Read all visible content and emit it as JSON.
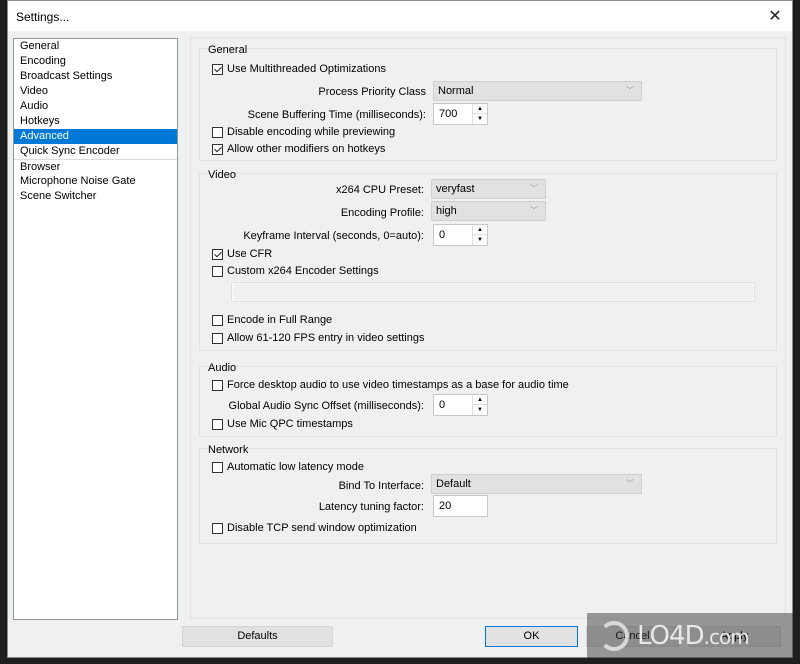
{
  "window": {
    "title": "Settings...",
    "close_icon": "close-icon"
  },
  "sidebar": {
    "items": [
      {
        "label": "General",
        "selected": false
      },
      {
        "label": "Encoding",
        "selected": false
      },
      {
        "label": "Broadcast Settings",
        "selected": false
      },
      {
        "label": "Video",
        "selected": false
      },
      {
        "label": "Audio",
        "selected": false
      },
      {
        "label": "Hotkeys",
        "selected": false
      },
      {
        "label": "Advanced",
        "selected": true
      },
      {
        "label": "Quick Sync Encoder",
        "selected": false
      },
      {
        "label": "Browser",
        "selected": false
      },
      {
        "label": "Microphone Noise Gate",
        "selected": false
      },
      {
        "label": "Scene Switcher",
        "selected": false
      }
    ]
  },
  "general": {
    "title": "General",
    "use_multithreaded": {
      "label": "Use Multithreaded Optimizations",
      "checked": true
    },
    "process_priority": {
      "label": "Process Priority Class",
      "value": "Normal"
    },
    "scene_buffering": {
      "label": "Scene Buffering Time (milliseconds):",
      "value": "700"
    },
    "disable_encoding_preview": {
      "label": "Disable encoding while previewing",
      "checked": false
    },
    "allow_modifiers": {
      "label": "Allow other modifiers on hotkeys",
      "checked": true
    }
  },
  "video": {
    "title": "Video",
    "cpu_preset": {
      "label": "x264 CPU Preset:",
      "value": "veryfast"
    },
    "encoding_profile": {
      "label": "Encoding Profile:",
      "value": "high"
    },
    "keyframe_interval": {
      "label": "Keyframe Interval (seconds, 0=auto):",
      "value": "0"
    },
    "use_cfr": {
      "label": "Use CFR",
      "checked": true
    },
    "custom_x264": {
      "label": "Custom x264 Encoder Settings",
      "checked": false,
      "value": ""
    },
    "full_range": {
      "label": "Encode in Full Range",
      "checked": false
    },
    "allow_high_fps": {
      "label": "Allow 61-120 FPS entry in video settings",
      "checked": false
    }
  },
  "audio": {
    "title": "Audio",
    "force_desktop_audio": {
      "label": "Force desktop audio to use video timestamps as a base for audio time",
      "checked": false
    },
    "sync_offset": {
      "label": "Global Audio Sync Offset (milliseconds):",
      "value": "0"
    },
    "mic_qpc": {
      "label": "Use Mic QPC timestamps",
      "checked": false
    }
  },
  "network": {
    "title": "Network",
    "auto_low_latency": {
      "label": "Automatic low latency mode",
      "checked": false
    },
    "bind_interface": {
      "label": "Bind To Interface:",
      "value": "Default"
    },
    "latency_factor": {
      "label": "Latency tuning factor:",
      "value": "20"
    },
    "disable_tcp_opt": {
      "label": "Disable TCP send window optimization",
      "checked": false
    }
  },
  "buttons": {
    "defaults": "Defaults",
    "ok": "OK",
    "cancel": "Cancel",
    "apply": "Apply"
  },
  "watermark": {
    "text": "LO4D",
    "suffix": ".com"
  },
  "colors": {
    "selection": "#0078d7",
    "window_bg": "#f0f0f0"
  }
}
